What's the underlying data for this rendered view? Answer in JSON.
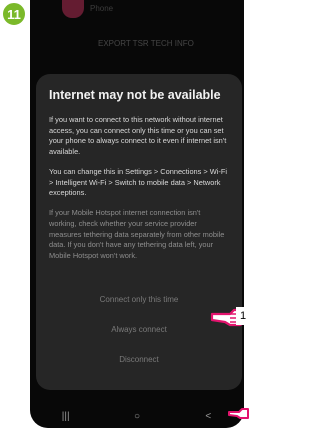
{
  "step_badge": "11",
  "background": {
    "row1": "Phone",
    "row2": "EXPORT TSR TECH INFO"
  },
  "dialog": {
    "title": "Internet may not be available",
    "para1": "If you want to connect to this network without internet access, you can connect only this time or you can set your phone to always connect to it even if internet isn't available.",
    "para2": "You can change this in Settings > Connections > Wi-Fi > Intelligent Wi-Fi > Switch to mobile data > Network exceptions.",
    "para3": "If your Mobile Hotspot internet connection isn't working, check whether your service provider measures tethering data separately from other mobile data. If you don't have any tethering data left, your Mobile Hotspot won't work.",
    "btn_once": "Connect only this time",
    "btn_always": "Always connect",
    "btn_disconnect": "Disconnect"
  },
  "navbar": {
    "recents": "|||",
    "home": "○",
    "back": "<"
  },
  "callout_number": "1",
  "colors": {
    "badge_green": "#7bb92a",
    "pointer_pink": "#e3146e",
    "dialog_bg": "#262626"
  }
}
